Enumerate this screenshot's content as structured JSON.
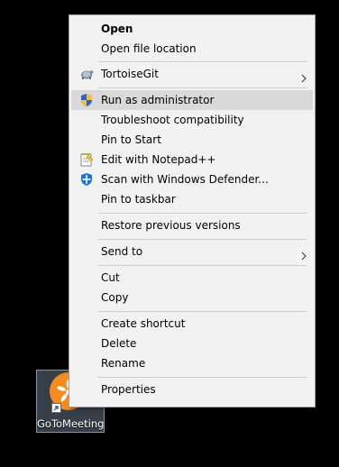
{
  "desktop": {
    "icon_label": "GoToMeeting"
  },
  "menu": {
    "items": [
      {
        "label": "Open"
      },
      {
        "label": "Open file location"
      },
      {
        "label": "TortoiseGit"
      },
      {
        "label": "Run as administrator"
      },
      {
        "label": "Troubleshoot compatibility"
      },
      {
        "label": "Pin to Start"
      },
      {
        "label": "Edit with Notepad++"
      },
      {
        "label": "Scan with Windows Defender..."
      },
      {
        "label": "Pin to taskbar"
      },
      {
        "label": "Restore previous versions"
      },
      {
        "label": "Send to"
      },
      {
        "label": "Cut"
      },
      {
        "label": "Copy"
      },
      {
        "label": "Create shortcut"
      },
      {
        "label": "Delete"
      },
      {
        "label": "Rename"
      },
      {
        "label": "Properties"
      }
    ]
  },
  "colors": {
    "menu_background": "#f2f2f2",
    "highlight": "#d9d9d9",
    "app_accent": "#f68b1f"
  },
  "icons": {
    "tortoisegit": "tortoisegit-icon",
    "run_as_admin": "uac-shield-icon",
    "notepad": "notepad-plus-plus-icon",
    "defender": "windows-defender-icon",
    "submenu": "chevron-right-icon",
    "app": "gotomeeting-icon"
  }
}
